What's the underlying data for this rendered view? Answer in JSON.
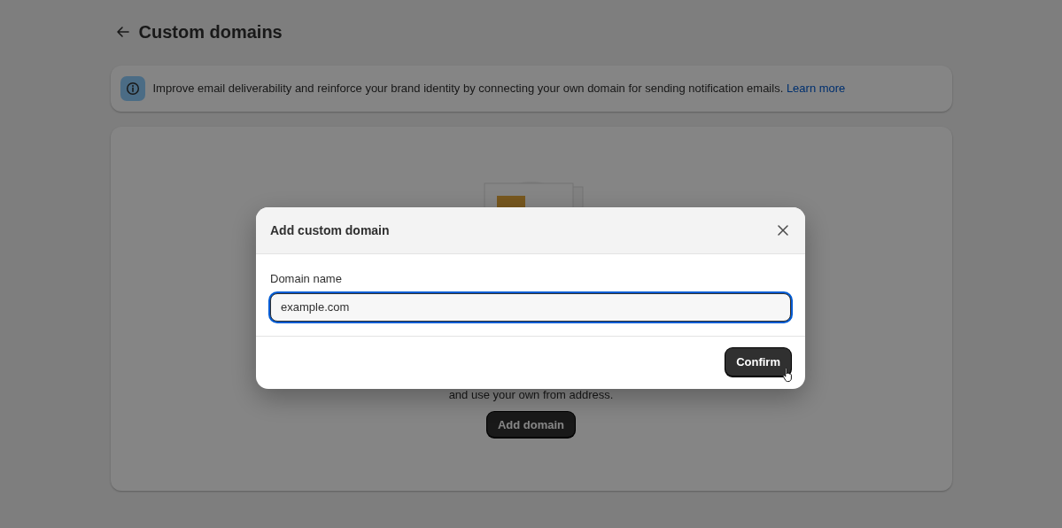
{
  "page": {
    "title": "Custom domains",
    "banner": {
      "text": "Improve email deliverability and reinforce your brand identity by connecting your own domain for sending notification emails.",
      "link": "Learn more"
    },
    "empty_state": {
      "text": "and use your own from address.",
      "button": "Add domain"
    }
  },
  "modal": {
    "title": "Add custom domain",
    "field": {
      "label": "Domain name",
      "value": "example.com",
      "focused": true
    },
    "confirm": "Confirm"
  }
}
